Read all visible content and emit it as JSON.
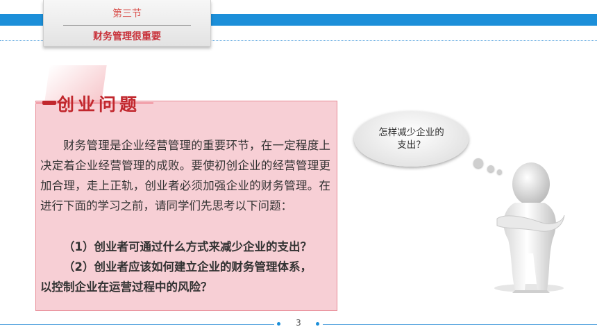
{
  "section": {
    "label": "第三节",
    "title": "财务管理很重要"
  },
  "panel": {
    "heading": "创业问题",
    "intro": "财务管理是企业经营管理的重要环节，在一定程度上决定着企业经营管理的成败。要使初创企业的经营管理更加合理，走上正轨，创业者必须加强企业的财务管理。在进行下面的学习之前，请同学们先思考以下问题：",
    "question1": "（1）创业者可通过什么方式来减少企业的支出？",
    "question2_line1": "（2）创业者应该如何建立企业的财务管理体系，",
    "question2_line2": "以控制企业在运营过程中的风险？"
  },
  "figure": {
    "bubble_text": "怎样减少企业的\n支出？"
  },
  "footer": {
    "page_number": "3"
  },
  "colors": {
    "accent_blue": "#1c8fd9",
    "heading_red": "#c1272d",
    "panel_pink": "#f7cfd5",
    "panel_border": "#e78a95"
  }
}
